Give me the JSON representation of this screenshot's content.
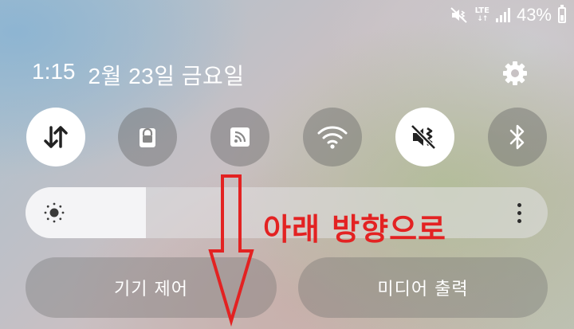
{
  "status_bar": {
    "network": "LTE",
    "battery_percent_text": "43%",
    "battery_level": 0.43,
    "icons": [
      "mute-vibrate-icon",
      "lte-data-icon",
      "signal-icon",
      "battery-icon"
    ]
  },
  "header": {
    "time": "1:15",
    "date": "2월 23일 금요일",
    "settings_icon": "gear-icon"
  },
  "quick_toggles": [
    {
      "name": "mobile-data",
      "icon": "data-arrows-icon",
      "state": "on"
    },
    {
      "name": "screen-lock",
      "icon": "lock-icon",
      "state": "off"
    },
    {
      "name": "nfc",
      "icon": "nfc-icon",
      "state": "off"
    },
    {
      "name": "wifi",
      "icon": "wifi-icon",
      "state": "off"
    },
    {
      "name": "sound-mode",
      "icon": "vibrate-mute-icon",
      "state": "on"
    },
    {
      "name": "bluetooth",
      "icon": "bluetooth-icon",
      "state": "off"
    }
  ],
  "brightness": {
    "level": 0.23,
    "icon": "sun-icon",
    "menu_icon": "more-vertical-icon"
  },
  "annotation": {
    "text": "아래 방향으로",
    "color": "#e32222"
  },
  "buttons": {
    "device_control": "기기 제어",
    "media_output": "미디어 출력"
  },
  "colors": {
    "toggle_on_bg": "#ffffff",
    "toggle_icon_dark": "#222222",
    "annotation_red": "#e32222"
  }
}
